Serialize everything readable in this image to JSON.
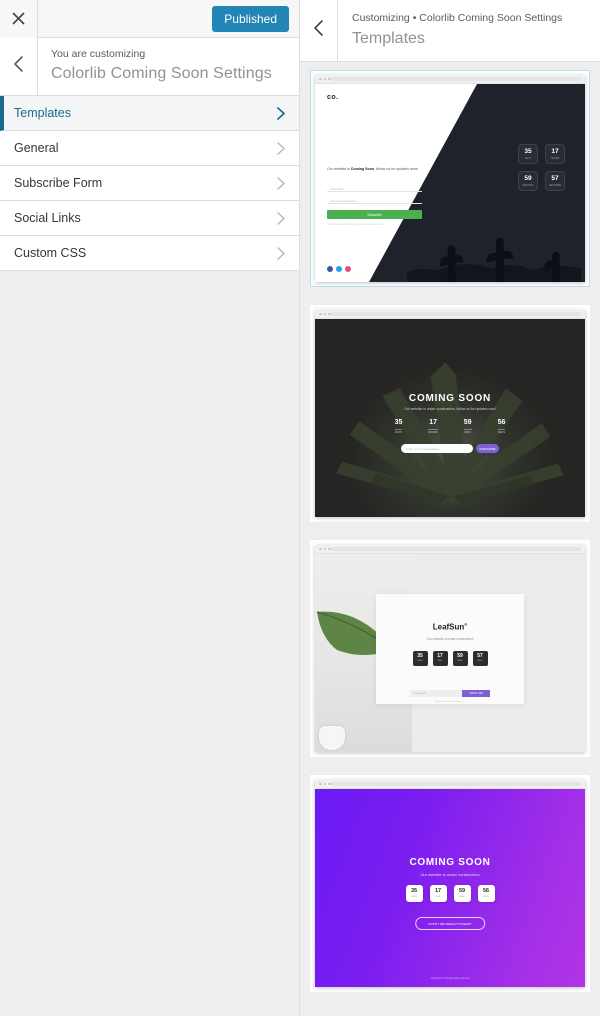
{
  "customizer": {
    "close_icon": "close-icon",
    "publish_button": "Published",
    "back_icon": "chevron-left-icon",
    "subtitle": "You are customizing",
    "title": "Colorlib Coming Soon Settings",
    "menu": [
      {
        "label": "Templates",
        "selected": true
      },
      {
        "label": "General",
        "selected": false
      },
      {
        "label": "Subscribe Form",
        "selected": false
      },
      {
        "label": "Social Links",
        "selected": false
      },
      {
        "label": "Custom CSS",
        "selected": false
      }
    ]
  },
  "preview": {
    "back_icon": "chevron-left-icon",
    "breadcrumb": "Customizing • Colorlib Coming Soon Settings",
    "title": "Templates",
    "templates": [
      {
        "name": "split-cactus-template",
        "selected": true,
        "logo": "co.",
        "copy_lead": "Our website is ",
        "copy_bold": "Coming Soon",
        "copy_tail": ", follow us for updates here!",
        "field_name_placeholder": "Your Name",
        "field_email_placeholder": "Your Email Address",
        "submit_label": "Subscribe",
        "fineprint": "We promise we will not spam you, we hate spam too.",
        "countdown": [
          {
            "value": "35",
            "unit": "DAYS"
          },
          {
            "value": "17",
            "unit": "HOURS"
          },
          {
            "value": "59",
            "unit": "MINUTES"
          },
          {
            "value": "57",
            "unit": "SECONDS"
          }
        ],
        "socials": [
          "facebook-icon",
          "twitter-icon",
          "dribbble-icon"
        ]
      },
      {
        "name": "aloe-dark-template",
        "selected": false,
        "title": "COMING SOON",
        "subtitle": "Our website is under construction, follow us for updates now!",
        "input_placeholder": "Enter your email address",
        "submit_label": "SUBSCRIBE",
        "countdown": [
          {
            "value": "35",
            "unit": "DAYS"
          },
          {
            "value": "17",
            "unit": "HOURS"
          },
          {
            "value": "59",
            "unit": "MINS"
          },
          {
            "value": "56",
            "unit": "SECS"
          }
        ]
      },
      {
        "name": "leafsun-template",
        "selected": false,
        "brand": "LeafSun",
        "brand_sup": "®",
        "subtitle": "Our website is under construction",
        "input_placeholder": "Your email",
        "submit_label": "NOTIFY ME",
        "fineprint": "We promise we will not spam you.",
        "countdown": [
          {
            "value": "35",
            "unit": "DAYS"
          },
          {
            "value": "17",
            "unit": "HRS"
          },
          {
            "value": "59",
            "unit": "MINS"
          },
          {
            "value": "57",
            "unit": "SECS"
          }
        ]
      },
      {
        "name": "purple-gradient-template",
        "selected": false,
        "title": "COMING SOON",
        "subtitle": "Our website is under construction",
        "button_label": "NOTIFY ME WHEN IT'S READY",
        "footer": "Copyright © 2019 All rights reserved",
        "countdown": [
          {
            "value": "35",
            "unit": "DAYS"
          },
          {
            "value": "17",
            "unit": "HRS"
          },
          {
            "value": "59",
            "unit": "MINS"
          },
          {
            "value": "56",
            "unit": "SECS"
          }
        ]
      }
    ]
  },
  "colors": {
    "publish_blue": "#2285b6",
    "selected_accent": "#1b6a8d",
    "panel_bg": "#eeeeee",
    "green_button": "#4caf50",
    "purple_button": "#7f5fd4",
    "gradient_start": "#6a1bf5",
    "gradient_end": "#b234e4"
  }
}
